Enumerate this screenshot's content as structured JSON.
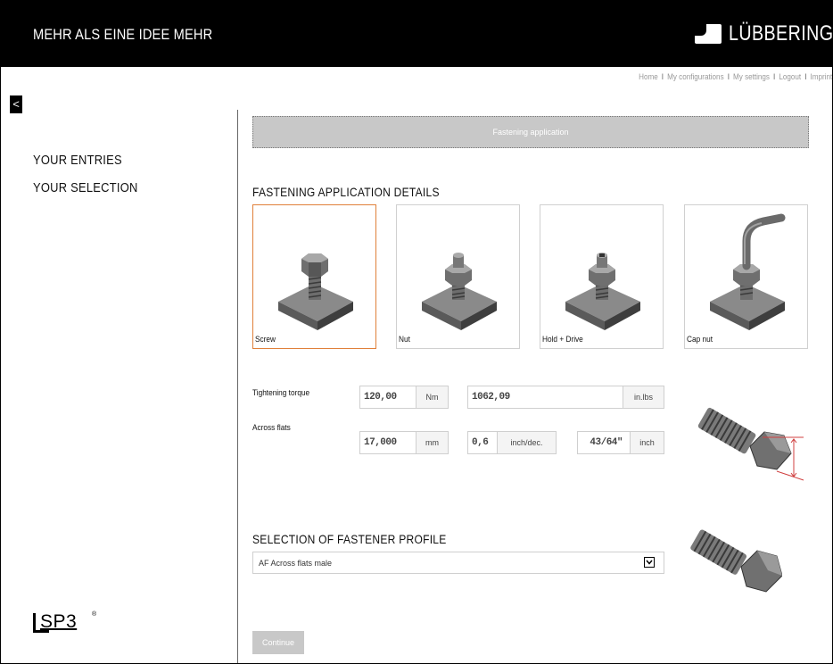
{
  "header": {
    "tagline": "MEHR ALS EINE IDEE MEHR",
    "brand": "LÜBBERING",
    "brand_reg": "®",
    "links": [
      "Home",
      "My configurations",
      "My settings",
      "Logout",
      "Imprint"
    ],
    "link_sep": "I"
  },
  "sidebar": {
    "back_symbol": "<",
    "items": [
      {
        "label": "YOUR ENTRIES"
      },
      {
        "label": "YOUR SELECTION"
      }
    ],
    "logo": {
      "prefix": "SP",
      "digit": "3",
      "reg": "®"
    }
  },
  "main": {
    "step_title": "Fastening application",
    "details_title": "FASTENING APPLICATION DETAILS",
    "options": [
      {
        "label": "Screw",
        "selected": true
      },
      {
        "label": "Nut",
        "selected": false
      },
      {
        "label": "Hold + Drive",
        "selected": false
      },
      {
        "label": "Cap nut",
        "selected": false
      }
    ],
    "torque": {
      "label": "Tightening torque",
      "value_nm": "120,00",
      "unit_nm": "Nm",
      "value_inlbs": "1062,09",
      "unit_inlbs": "in.lbs"
    },
    "across_flats": {
      "label": "Across flats",
      "value_mm": "17,000",
      "unit_mm": "mm",
      "value_dec": "0,6",
      "unit_dec": "inch/dec.",
      "value_frac": "43/64\"",
      "unit_frac": "inch"
    },
    "profile_title": "SELECTION OF FASTENER PROFILE",
    "profile_selected": "AF Across flats male",
    "continue_label": "Continue"
  },
  "colors": {
    "header_bg": "#000000",
    "selected_border": "#e0803a",
    "step_bar": "#c8c8c8",
    "dimension_line": "#d04040"
  },
  "icons": {
    "back": "chevron-left-icon",
    "dropdown": "chevron-down-icon"
  }
}
